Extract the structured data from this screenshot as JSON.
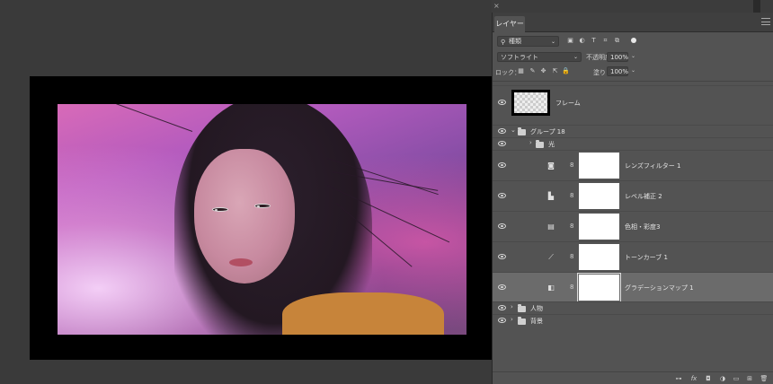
{
  "panel": {
    "close": "×",
    "tab": "レイヤー",
    "filter": {
      "icon": "search-icon",
      "kind": "種類",
      "caret": "⌄"
    },
    "blend_mode": "ソフトライト",
    "opacity_label": "不透明度：",
    "opacity": "100%",
    "lock_label": "ロック：",
    "fill_label": "塗り：",
    "fill": "100%"
  },
  "layers": [
    {
      "name": "フレーム",
      "kind": "pixel"
    },
    {
      "name": "グループ 18",
      "kind": "group",
      "expanded": true
    },
    {
      "name": "光",
      "kind": "group",
      "expanded": false
    },
    {
      "name": "レンズフィルター 1",
      "kind": "adjustment",
      "icon": "camera-filter-icon"
    },
    {
      "name": "レベル補正 2",
      "kind": "adjustment",
      "icon": "levels-icon"
    },
    {
      "name": "色相・彩度3",
      "kind": "adjustment",
      "icon": "hue-saturation-icon"
    },
    {
      "name": "トーンカーブ 1",
      "kind": "adjustment",
      "icon": "curves-icon"
    },
    {
      "name": "グラデーションマップ 1",
      "kind": "adjustment",
      "icon": "gradient-map-icon",
      "selected": true
    },
    {
      "name": "人物",
      "kind": "group",
      "expanded": false
    },
    {
      "name": "背景",
      "kind": "group",
      "expanded": false
    }
  ],
  "bottom_icons": [
    "link-icon",
    "fx-icon",
    "mask-icon",
    "adjustment-icon",
    "folder-icon",
    "new-layer-icon",
    "trash-icon"
  ],
  "glyphs": {
    "fx": "fx",
    "chain": "8",
    "caret": "⌄",
    "arrow": "›",
    "fold": "⌄"
  }
}
